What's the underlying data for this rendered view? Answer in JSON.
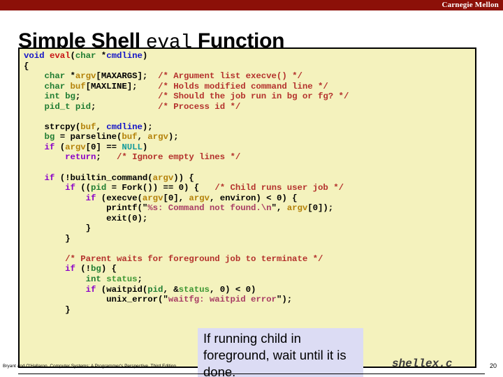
{
  "banner": {
    "institution": "Carnegie Mellon",
    "color": "#8c1008"
  },
  "title": {
    "prefix": "Simple Shell ",
    "mono": "eval",
    "suffix": " Function"
  },
  "code": {
    "language": "c",
    "filename": "shellex.c",
    "background": "#f4f2bd",
    "lines": [
      "void eval(char *cmdline)",
      "{",
      "    char *argv[MAXARGS];  /* Argument list execve() */",
      "    char buf[MAXLINE];    /* Holds modified command line */",
      "    int bg;               /* Should the job run in bg or fg? */",
      "    pid_t pid;            /* Process id */",
      "",
      "    strcpy(buf, cmdline);",
      "    bg = parseline(buf, argv);",
      "    if (argv[0] == NULL)",
      "        return;   /* Ignore empty lines */",
      "",
      "    if (!builtin_command(argv)) {",
      "        if ((pid = Fork()) == 0) {   /* Child runs user job */",
      "            if (execve(argv[0], argv, environ) < 0) {",
      "                printf(\"%s: Command not found.\\n\", argv[0]);",
      "                exit(0);",
      "            }",
      "        }",
      "",
      "        /* Parent waits for foreground job to terminate */",
      "        if (!bg) {",
      "            int status;",
      "            if (waitpid(pid, &status, 0) < 0)",
      "                unix_error(\"waitfg: waitpid error\");",
      "        }"
    ]
  },
  "callout": {
    "text": "If running child in foreground, wait until it is done.",
    "background": "#dcdcf4"
  },
  "footer": {
    "credit": "Bryant and O'Hallaron, Computer Systems: A Programmer's Perspective, Third Edition",
    "page": "20"
  }
}
